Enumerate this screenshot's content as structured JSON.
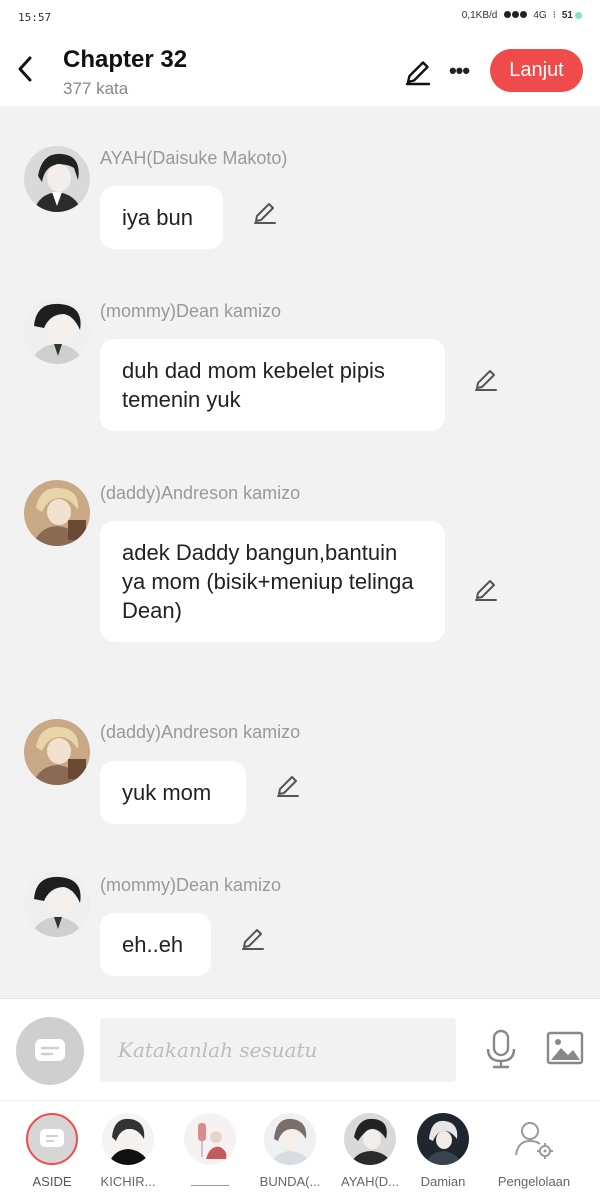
{
  "status_bar": {
    "time": "15:57",
    "net_speed": "0,1KB/d",
    "network": "4G",
    "battery": "51"
  },
  "header": {
    "title": "Chapter 32",
    "word_count": "377 kata",
    "next_label": "Lanjut"
  },
  "messages": [
    {
      "name": "AYAH(Daisuke Makoto)",
      "text": "iya bun"
    },
    {
      "name": "(mommy)Dean kamizo",
      "text": "duh dad mom kebelet pipis temenin yuk"
    },
    {
      "name": "(daddy)Andreson kamizo",
      "text": "adek Daddy bangun,bantuin ya mom (bisik+meniup telinga Dean)"
    },
    {
      "name": "(daddy)Andreson kamizo",
      "text": "yuk mom"
    },
    {
      "name": "(mommy)Dean kamizo",
      "text": "eh..eh"
    }
  ],
  "composer": {
    "placeholder": "Katakanlah sesuatu"
  },
  "bottom_nav": [
    {
      "label": "ASIDE"
    },
    {
      "label": "KICHIR..."
    },
    {
      "label": ""
    },
    {
      "label": "BUNDA(..."
    },
    {
      "label": "AYAH(D..."
    },
    {
      "label": "Damian"
    },
    {
      "label": "Pengelolaan"
    }
  ],
  "colors": {
    "accent": "#f04b4b",
    "background": "#f2f2f2",
    "bubble": "#ffffff",
    "name_text": "#999999"
  }
}
